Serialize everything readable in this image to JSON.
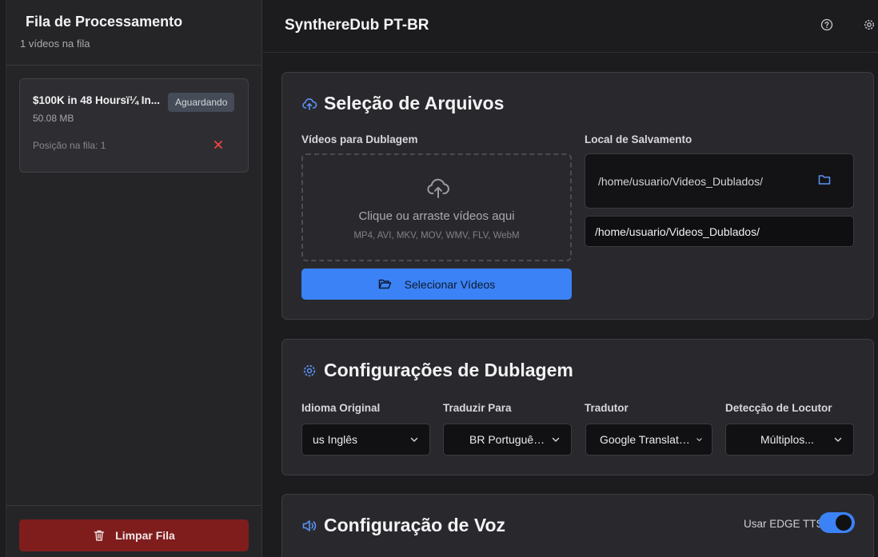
{
  "sidebar": {
    "title": "Fila de Processamento",
    "subtitle": "1 vídeos na fila",
    "queue": [
      {
        "name": "$100K in 48 Hoursï¼ In...",
        "status": "Aguardando",
        "size": "50.08 MB",
        "position": "Posição na fila: 1"
      }
    ],
    "clear_label": "Limpar Fila"
  },
  "header": {
    "title": "SynthereDub PT-BR"
  },
  "files": {
    "title": "Seleção de Arquivos",
    "videos_label": "Vídeos para Dublagem",
    "dropzone_text": "Clique ou arraste vídeos aqui",
    "dropzone_formats": "MP4, AVI, MKV, MOV, WMV, FLV, WebM",
    "select_button": "Selecionar Vídeos",
    "save_label": "Local de Salvamento",
    "save_path": "/home/usuario/Videos_Dublados/",
    "save_input_value": "/home/usuario/Videos_Dublados/"
  },
  "dubbing": {
    "title": "Configurações de Dublagem",
    "fields": [
      {
        "label": "Idioma Original",
        "value": "us Inglês"
      },
      {
        "label": "Traduzir Para",
        "value": "BR Português..."
      },
      {
        "label": "Tradutor",
        "value": "Google Translator..."
      },
      {
        "label": "Detecção de Locutor",
        "value": "Múltiplos..."
      }
    ]
  },
  "voice": {
    "title": "Configuração de Voz",
    "toggle_label": "Usar EDGE TTS",
    "toggle_on": true
  },
  "colors": {
    "accent": "#3b82f6",
    "danger": "#7f1d1d",
    "danger_icon": "#ef4444"
  }
}
